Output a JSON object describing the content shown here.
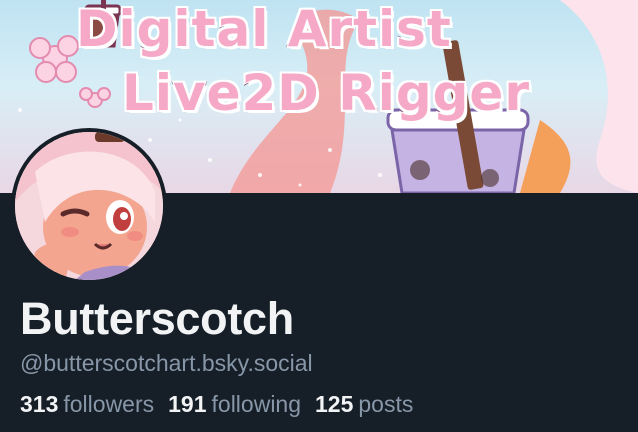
{
  "banner": {
    "line1": "Digital Artist",
    "line2": "Live2D Rigger",
    "cup_icon": "bubble-tea-cup-icon",
    "flower_icon": "sakura-flower-icon"
  },
  "avatar": {
    "icon": "avatar-illustration"
  },
  "profile": {
    "display_name": "Butterscotch",
    "handle": "@butterscotchart.bsky.social"
  },
  "stats": {
    "followers_count": "313",
    "followers_label": "followers",
    "following_count": "191",
    "following_label": "following",
    "posts_count": "125",
    "posts_label": "posts"
  },
  "colors": {
    "background": "#161e27",
    "primary_text": "#f1f3f5",
    "secondary_text": "#8797a8",
    "banner_text": "#f6a9c7"
  }
}
